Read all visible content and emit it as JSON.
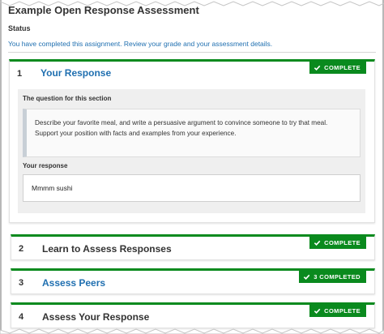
{
  "page": {
    "title": "Example Open Response Assessment",
    "status_label": "Status",
    "status_text": "You have completed this assignment. Review your grade and your assessment details."
  },
  "steps": [
    {
      "number": "1",
      "name": "Your Response",
      "badge": "COMPLETE",
      "question_label": "The question for this section",
      "question_text": "Describe your favorite meal, and write a persuasive argument to convince someone to try that meal. Support your position with facts and examples from your experience.",
      "response_label": "Your response",
      "response_text": "Mmmm sushi"
    },
    {
      "number": "2",
      "name": "Learn to Assess Responses",
      "badge": "COMPLETE"
    },
    {
      "number": "3",
      "name": "Assess Peers",
      "badge": "3 COMPLETED"
    },
    {
      "number": "4",
      "name": "Assess Your Response",
      "badge": "COMPLETE"
    }
  ],
  "colors": {
    "accent_green": "#0a8a1e",
    "link_blue": "#1f6fb0",
    "panel_gray": "#efefef"
  },
  "icons": {
    "badge_icon": "checkmark-icon"
  }
}
